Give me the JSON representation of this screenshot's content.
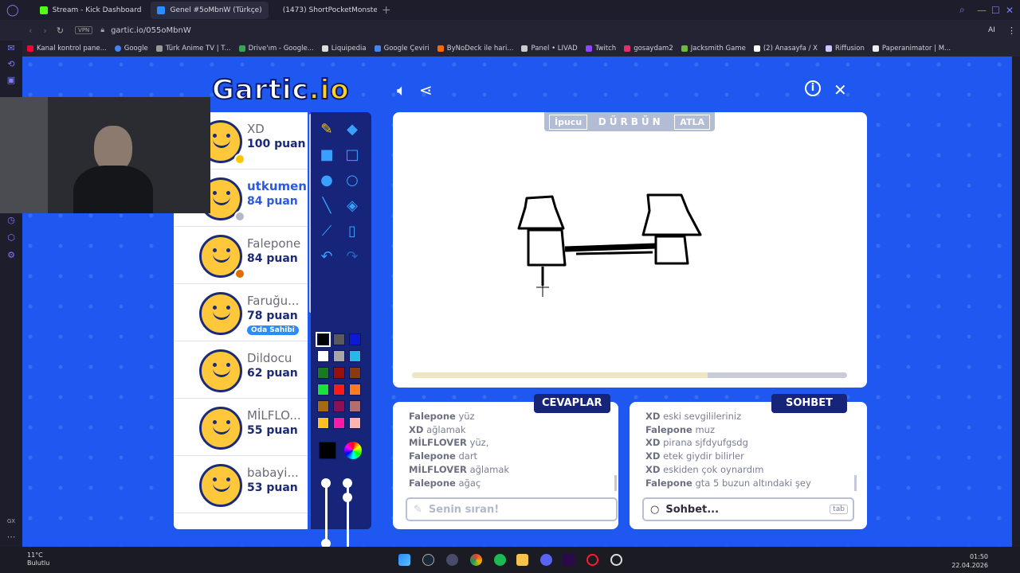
{
  "browser": {
    "tabs": [
      {
        "label": "Stream - Kick Dashboard",
        "color": "#53fc18"
      },
      {
        "label": "Genel #5oMbnW (Türkçe)",
        "color": "#2a8cff"
      },
      {
        "label": "(1473) ShortPocketMonste",
        "color": "#ff0033"
      }
    ],
    "url": "gartic.io/055oMbnW",
    "vpn": "VPN",
    "bookmarks": [
      "Kanal kontrol pane...",
      "Google",
      "Türk Anime TV | T...",
      "Drive'ım - Google...",
      "Liquipedia",
      "Google Çeviri",
      "ByNoDeck ile hari...",
      "Panel • LIVAD",
      "Twitch",
      "gosaydam2",
      "Jacksmith Game",
      "(2) Anasayfa / X",
      "Riffusion",
      "Paperanimator | M..."
    ],
    "ai_label": "AI"
  },
  "game": {
    "logo_main": "Gartic",
    "logo_suffix": ".io",
    "hint": {
      "left": "İpucu",
      "word": "DÜRBÜN",
      "right": "ATLA"
    },
    "timer_progress": 0.68,
    "players": [
      {
        "name": "XD",
        "score": "100 puan",
        "dot": "#ffc400"
      },
      {
        "name": "utkumen",
        "score": "84 puan",
        "dot": "#b5b9c6",
        "me": true
      },
      {
        "name": "Falepone",
        "score": "84 puan",
        "dot": "#e36b00"
      },
      {
        "name": "Faruğu...",
        "score": "78 puan",
        "badge": "Oda Sahibi"
      },
      {
        "name": "Dildocu",
        "score": "62 puan"
      },
      {
        "name": "MİLFLO...",
        "score": "55 puan"
      },
      {
        "name": "babayi...",
        "score": "53 puan"
      }
    ],
    "answers_title": "CEVAPLAR",
    "answers": [
      {
        "user": "Falepone",
        "text": "yüz"
      },
      {
        "user": "XD",
        "text": "ağlamak"
      },
      {
        "user": "MİLFLOVER",
        "text": "yüz,"
      },
      {
        "user": "Falepone",
        "text": "dart"
      },
      {
        "user": "MİLFLOVER",
        "text": "ağlamak"
      },
      {
        "user": "Falepone",
        "text": "ağaç"
      }
    ],
    "answer_placeholder": "Senin sıran!",
    "chat_title": "SOHBET",
    "chat": [
      {
        "user": "XD",
        "text": "eski sevgilileriniz"
      },
      {
        "user": "Falepone",
        "text": "muz"
      },
      {
        "user": "XD",
        "text": "pirana sjfdyufgsdg"
      },
      {
        "user": "XD",
        "text": "etek giydir bilirler"
      },
      {
        "user": "XD",
        "text": "eskiden çok oynardım"
      },
      {
        "user": "Falepone",
        "text": "gta 5 buzun altındaki şey"
      }
    ],
    "chat_placeholder": "Sohbet...",
    "chat_key": "tab",
    "palette": [
      "#000000",
      "#5a5a5a",
      "#0a1ad8",
      "#ffffff",
      "#a6a6a6",
      "#27b8e8",
      "#1a7a22",
      "#9b0f0f",
      "#8a3a10",
      "#19e23a",
      "#ff1a1a",
      "#ff7a22",
      "#a56b12",
      "#8f0f55",
      "#b46e6e",
      "#ffc020",
      "#ff1aa8",
      "#ffb3b3"
    ]
  },
  "taskbar": {
    "weather_temp": "11°C",
    "weather_text": "Bulutlu",
    "time": "01:50",
    "date": "22.04.2026"
  }
}
